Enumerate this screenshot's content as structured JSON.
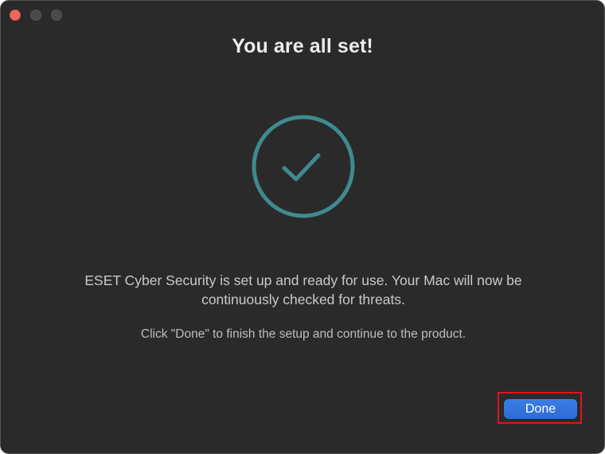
{
  "window": {
    "traffic_lights": [
      "close",
      "minimize",
      "zoom"
    ]
  },
  "header": {
    "title": "You are all set!"
  },
  "status": {
    "icon": "checkmark-circle-icon",
    "accent_color": "#3f8a8f"
  },
  "body": {
    "message": "ESET Cyber Security is set up and ready for use. Your Mac will now be continuously checked for threats.",
    "hint": "Click \"Done\" to finish the setup and continue to the product."
  },
  "footer": {
    "done_label": "Done",
    "done_color": "#3276dd",
    "highlight_color": "#e0141e"
  }
}
